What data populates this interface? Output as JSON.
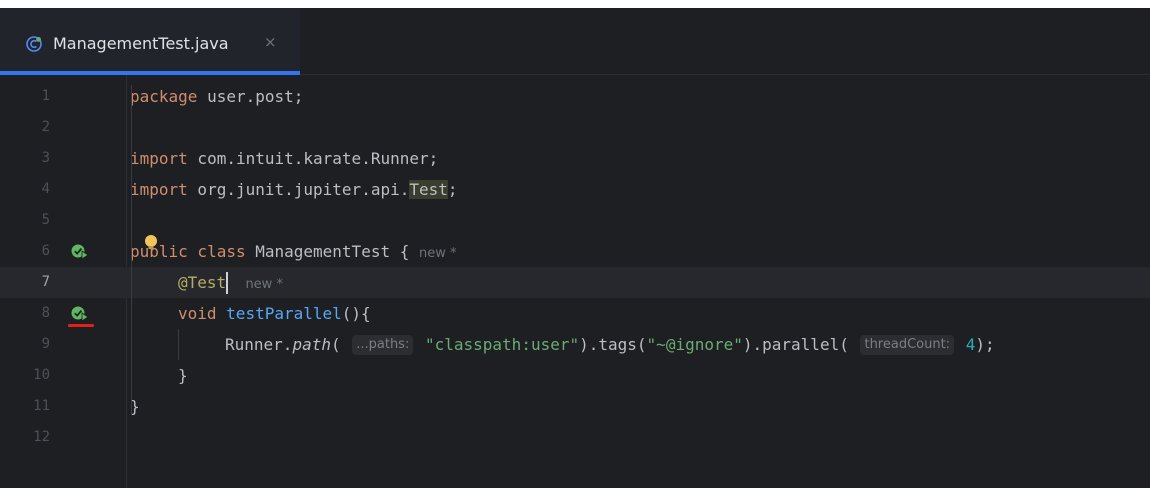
{
  "tab": {
    "label": "ManagementTest.java",
    "close": "×",
    "icon": "java-class-icon"
  },
  "editor": {
    "current_line": 7,
    "lines": [
      {
        "num": "1"
      },
      {
        "num": "2"
      },
      {
        "num": "3"
      },
      {
        "num": "4"
      },
      {
        "num": "5"
      },
      {
        "num": "6"
      },
      {
        "num": "7"
      },
      {
        "num": "8"
      },
      {
        "num": "9"
      },
      {
        "num": "10"
      },
      {
        "num": "11"
      },
      {
        "num": "12"
      }
    ],
    "code": {
      "l1_kw": "package",
      "l1_rest": " user.post;",
      "l3_kw": "import",
      "l3_rest": " com.intuit.karate.Runner;",
      "l4_kw": "import",
      "l4_rest": " org.junit.jupiter.api.",
      "l4_hl": "Test",
      "l4_end": ";",
      "l6_kw": "public class",
      "l6_rest": " ManagementTest { ",
      "l6_hint": "new *",
      "l7_ann": "@Test",
      "l7_hint": "new *",
      "l8_kw": "void",
      "l8_fn": "testParallel",
      "l8_end": "(){",
      "l9_obj": "Runner.",
      "l9_path": "path",
      "l9_open": "( ",
      "l9_param1": "...paths:",
      "l9_str1": "\"classpath:user\"",
      "l9_mid": ").tags(",
      "l9_str2": "\"~@ignore\"",
      "l9_mid2": ").parallel( ",
      "l9_param2": "threadCount:",
      "l9_num": "4",
      "l9_end": ");",
      "l10": "}",
      "l11": "}"
    },
    "gutter_icons": [
      "run-test-icon",
      "run-test-icon"
    ],
    "colors": {
      "background": "#1e1f22",
      "keyword": "#cf8e6d",
      "annotation": "#b3ae60",
      "function": "#56a8f5",
      "string": "#6aab73",
      "number": "#2aacb8",
      "tab_accent": "#3574f0",
      "error_underline": "#e0201d"
    }
  }
}
